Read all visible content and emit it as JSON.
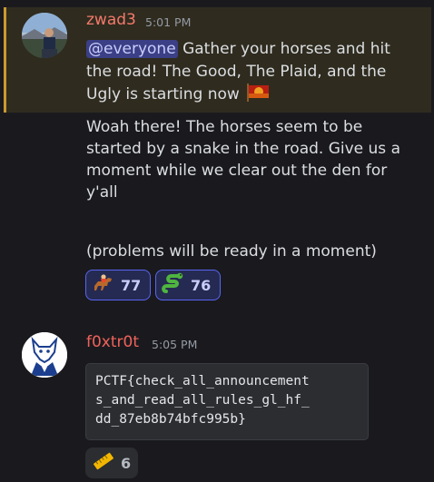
{
  "messages": [
    {
      "author": "zwad3",
      "time": "5:01 PM",
      "mention": "@everyone",
      "line1_rest": " Gather your horses and hit",
      "line2": "the road! The Good, The Plaid, and the",
      "line3": "Ugly is starting now",
      "line3_icon": "racing-flag-icon",
      "body_lines": [
        "Woah there! The horses seem to be",
        "started by a snake in the road. Give us a",
        "moment while we clear out the den for",
        "y'all",
        "(problems will be ready in a moment)"
      ],
      "reactions": [
        {
          "icon": "horse-racing-icon",
          "count": "77"
        },
        {
          "icon": "snake-icon",
          "count": "76"
        }
      ]
    },
    {
      "author": "f0xtr0t",
      "time": "5:05 PM",
      "code_lines": [
        "PCTF{check_all_announcement",
        "s_and_read_all_rules_gl_hf_",
        "dd_87eb8b74bfc995b}"
      ],
      "reactions": [
        {
          "icon": "ruler-icon",
          "count": "6"
        }
      ]
    }
  ]
}
